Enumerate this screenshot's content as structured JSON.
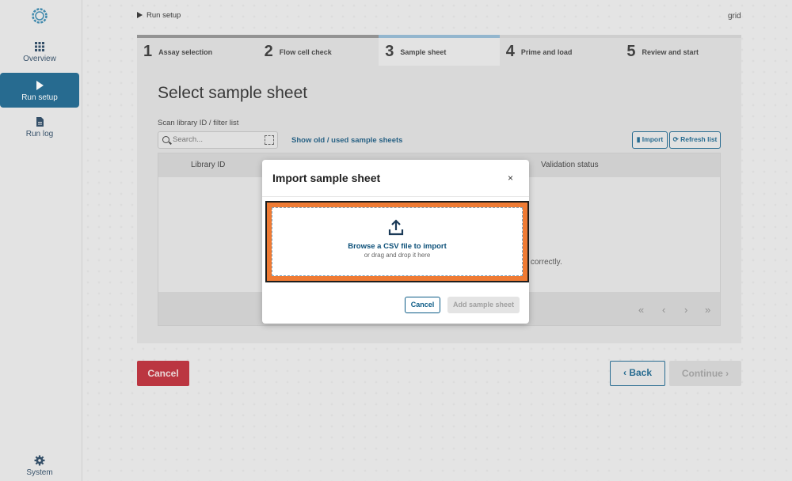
{
  "sidebar": {
    "items": [
      {
        "label": "Overview",
        "icon": "grid-icon"
      },
      {
        "label": "Run setup",
        "icon": "play-icon"
      },
      {
        "label": "Run log",
        "icon": "document-icon"
      }
    ],
    "bottom": {
      "label": "System",
      "icon": "gear-icon"
    }
  },
  "breadcrumb": "Run setup",
  "top_right_label": "grid",
  "steps": [
    {
      "num": "1",
      "label": "Assay selection"
    },
    {
      "num": "2",
      "label": "Flow cell check"
    },
    {
      "num": "3",
      "label": "Sample sheet"
    },
    {
      "num": "4",
      "label": "Prime and load"
    },
    {
      "num": "5",
      "label": "Review and start"
    }
  ],
  "main": {
    "title": "Select sample sheet",
    "scan_label": "Scan library ID / filter list",
    "search_placeholder": "Search...",
    "show_old_link": "Show old / used sample sheets",
    "import_button": "Import",
    "refresh_button": "Refresh list",
    "table_headers": [
      "Library ID",
      "Validation status"
    ],
    "empty_message_fragment": "ed correctly."
  },
  "footer": {
    "cancel": "Cancel",
    "back": "Back",
    "continue": "Continue"
  },
  "modal": {
    "title": "Import sample sheet",
    "close": "×",
    "drop_main": "Browse a CSV file to import",
    "drop_sub": "or drag and drop it here",
    "cancel": "Cancel",
    "add": "Add sample sheet"
  },
  "colors": {
    "accent": "#0b5b86",
    "danger": "#b91d2a",
    "highlight": "#ef7b34"
  }
}
